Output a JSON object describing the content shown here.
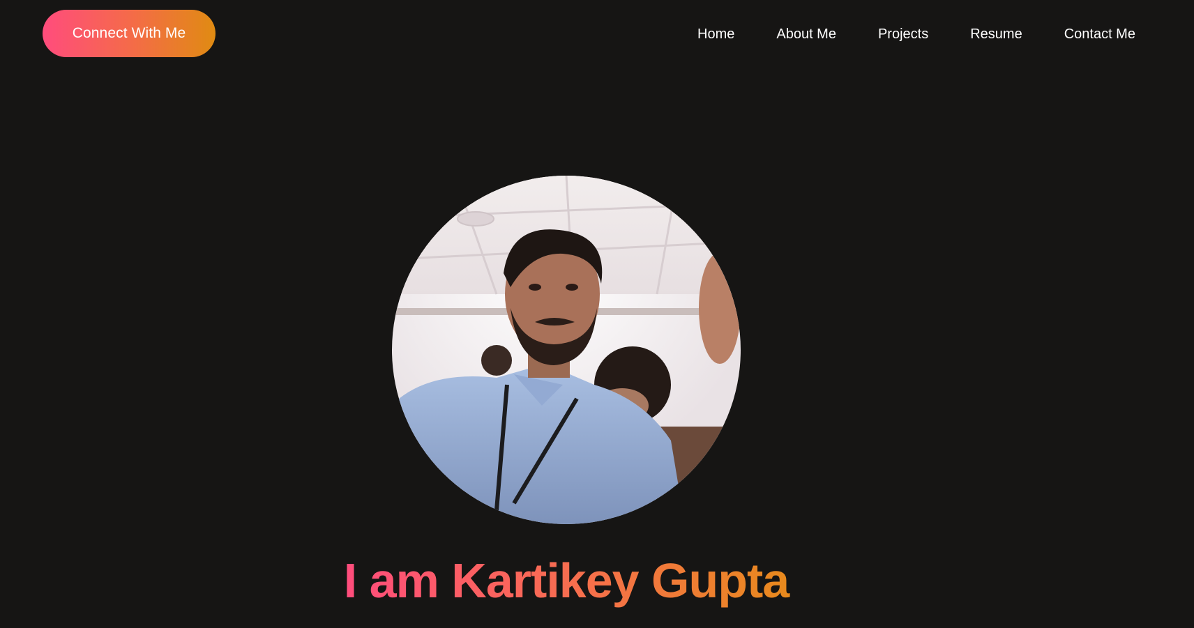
{
  "header": {
    "cta_label": "Connect With Me",
    "nav_items": [
      {
        "label": "Home"
      },
      {
        "label": "About Me"
      },
      {
        "label": "Projects"
      },
      {
        "label": "Resume"
      },
      {
        "label": "Contact Me"
      }
    ]
  },
  "hero": {
    "title": "I am Kartikey Gupta"
  },
  "colors": {
    "background": "#161514",
    "gradient_start": "#ff4c7d",
    "gradient_end": "#e08b12",
    "nav_text": "#ffffff"
  }
}
